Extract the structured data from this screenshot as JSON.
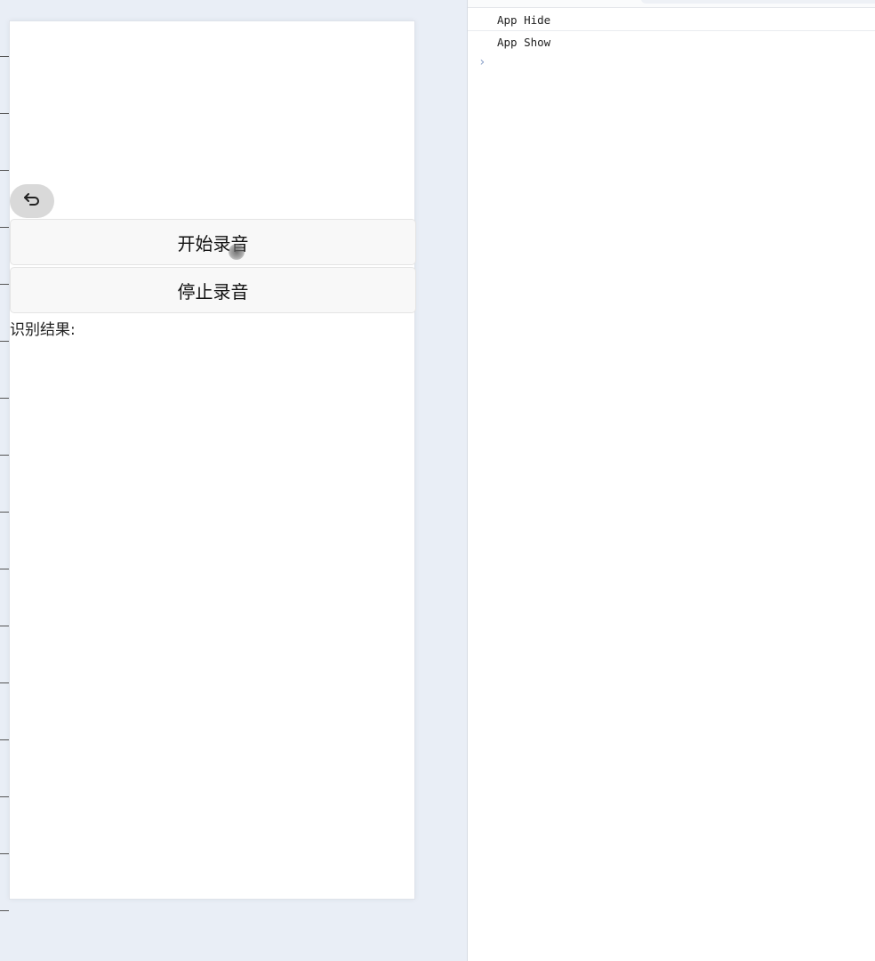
{
  "preview": {
    "start_button": "开始录音",
    "stop_button": "停止录音",
    "result_label": "识别结果:"
  },
  "console": {
    "lines": [
      "App Hide",
      "App Show"
    ],
    "prompt": "›"
  },
  "icons": {
    "back": "undo-arrow-icon",
    "prompt": "chevron-right-icon"
  },
  "colors": {
    "page_bg": "#e9eef6",
    "button_bg": "#f8f8f8",
    "prompt": "#8aa0c8"
  }
}
